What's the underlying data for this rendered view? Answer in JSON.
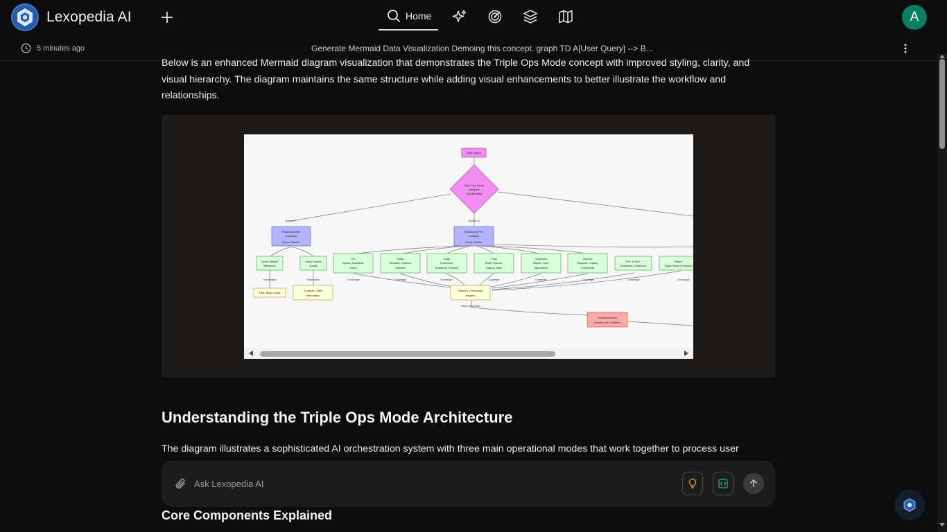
{
  "app": {
    "name": "Lexopedia AI"
  },
  "nav": {
    "home_label": "Home",
    "icons": [
      "sparkle-icon",
      "target-icon",
      "layers-icon",
      "map-icon"
    ]
  },
  "user": {
    "initial": "A",
    "avatar_color": "#0a7f62"
  },
  "thread": {
    "time": "5 minutes ago",
    "title": "Generate Mermaid Data Visualization Demoing this concept. graph TD A[User Query] --> B..."
  },
  "content": {
    "intro": "Below is an enhanced Mermaid diagram visualization that demonstrates the Triple Ops Mode concept with improved styling, clarity, and visual hierarchy. The diagram maintains the same structure while adding visual enhancements to better illustrate the workflow and relationships.",
    "heading": "Understanding the Triple Ops Mode Architecture",
    "paragraph": "The diagram illustrates a sophisticated AI orchestration system with three main operational modes that work together to process user",
    "subheading": "Core Components Explained"
  },
  "diagram": {
    "nodes": {
      "user_query": "User Query",
      "orchestrator": [
        "Triple Ops Mode:",
        "Autopilot",
        "Orchestration"
      ],
      "reasoning_lite": [
        "Reasoning-lite:",
        "Balanced",
        "Expert Search"
      ],
      "reasoning_pro": [
        "Reasoning-Pro:",
        "Analysis",
        "Deep Studies"
      ],
      "quick_search": [
        "Quick Search",
        "Efficiency"
      ],
      "deep_search": [
        "Deep Search",
        "Quality"
      ],
      "pro": [
        "Pro",
        "Hybrid, Analytical,",
        "Vision"
      ],
      "flash": [
        "Flash",
        "Versatile, Optimal,",
        "Efficient"
      ],
      "edge": [
        "Edge",
        "Enhanced,",
        "Analytical, Efficient"
      ],
      "flow": [
        "Flow",
        "Math, Sparse,",
        "Logical, Agile"
      ],
      "essential": [
        "Essential",
        "Simple, Core,",
        "Algorithmic"
      ],
      "default": [
        "Default",
        "Flagship, Legacy,",
        "Contextual"
      ],
      "pro_plus": [
        "Pro* & Pro+",
        "Extended, Enhanced"
      ],
      "flash_plus": [
        "Flash+",
        "Rapid Deep Research"
      ],
      "fast_facts": "Fast, Basic Facts",
      "in_depth": [
        "In-depth, Cited",
        "Information"
      ],
      "refined": [
        "Refined, Contextual",
        "Insights"
      ],
      "final": [
        "Comprehensive",
        "Answer with Citations"
      ]
    },
    "edges": {
      "branch1": "Branch 1",
      "branch2": "Branch 2",
      "generates": "Generates",
      "converge": "Converge",
      "final_integration": "Final Integration"
    }
  },
  "composer": {
    "placeholder": "Ask Lexopedia AI"
  },
  "colors": {
    "background": "#0d0d0d",
    "card": "#1d1a18",
    "accent_green": "#0a7f62",
    "node_pink": "#f28ef2",
    "node_purple": "#b3b3ff",
    "node_green": "#d9ffd9",
    "node_yellow": "#ffffd9",
    "node_red": "#ffa8a8"
  }
}
